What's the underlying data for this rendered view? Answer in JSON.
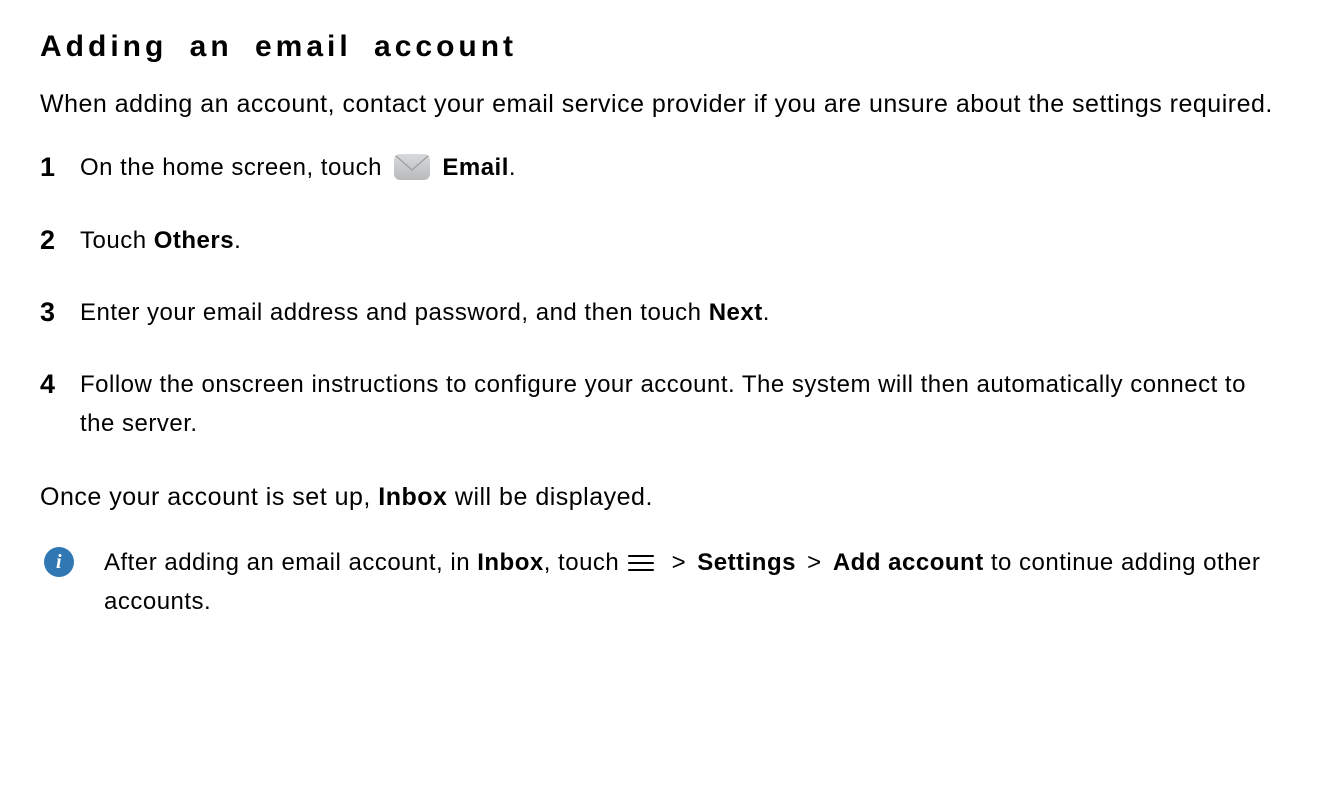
{
  "title": "Adding an email account",
  "intro": "When adding an account, contact your email service provider if you are unsure about the settings required.",
  "steps": {
    "s1": {
      "pre": "On the home screen, touch ",
      "label": "Email",
      "post": "."
    },
    "s2": {
      "pre": "Touch ",
      "label": "Others",
      "post": "."
    },
    "s3": {
      "pre": "Enter your email address and password, and then touch ",
      "label": "Next",
      "post": "."
    },
    "s4": {
      "text": "Follow the onscreen instructions to configure your account. The system will then automatically connect to the server."
    }
  },
  "after": {
    "pre": "Once your account is set up, ",
    "label": "Inbox",
    "post": " will be displayed."
  },
  "note": {
    "pre": "After adding an email account, in ",
    "inbox": "Inbox",
    "mid1": ", touch ",
    "gt1": ">",
    "settings": "Settings",
    "gt2": ">",
    "add": "Add account",
    "post": " to continue adding other accounts."
  },
  "info_glyph": "i"
}
